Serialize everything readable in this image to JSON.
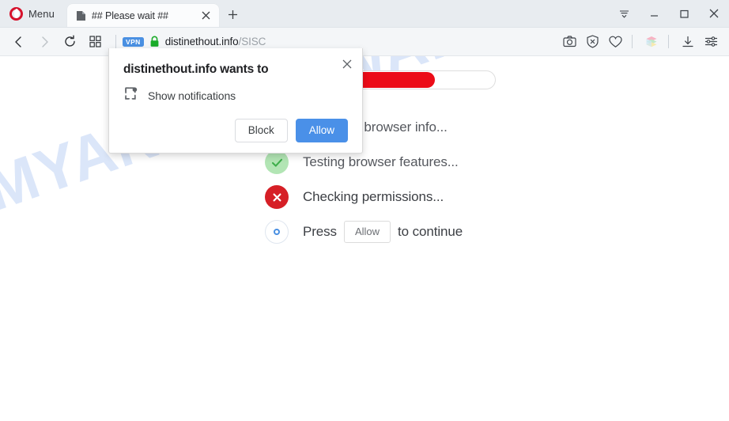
{
  "window": {
    "menu_label": "Menu",
    "opera_logo_color": "#d6122c",
    "controls": {
      "tab_list": "tab-list-chevron",
      "minimize": "minimize",
      "maximize": "maximize",
      "close": "close"
    }
  },
  "tabs": [
    {
      "title": "## Please wait ##",
      "favicon": "page-icon",
      "active": true
    }
  ],
  "newtab_label": "+",
  "toolbar": {
    "back": "back-arrow",
    "forward": "forward-arrow",
    "reload": "reload",
    "grid": "speed-dial-grid",
    "vpn_badge": "VPN",
    "lock": "secure-lock",
    "url_host": "distinethout.info",
    "url_path": "/SISC",
    "right_icons": [
      "snapshot-camera-icon",
      "ad-blocker-shield-icon",
      "heart-icon",
      "workspaces-cube-icon",
      "downloads-icon",
      "easy-setup-icon"
    ]
  },
  "page": {
    "watermark": "MYANTISPYWARE.COM",
    "progress": {
      "percent": 74,
      "fill_color": "#ec0c18"
    },
    "steps": [
      {
        "label": "Analyzing browser info...",
        "state": "ok",
        "glyph": "check"
      },
      {
        "label": "Testing browser features...",
        "state": "ok",
        "glyph": "check"
      },
      {
        "label": "Checking permissions...",
        "state": "bad",
        "glyph": "cross"
      }
    ],
    "press_row": {
      "prefix": "Press",
      "button_label": "Allow",
      "suffix": "to continue",
      "state": "pending"
    }
  },
  "permission_dialog": {
    "title": "distinethout.info wants to",
    "permission_icon": "notification-bell-icon",
    "permission_text": "Show notifications",
    "block_label": "Block",
    "allow_label": "Allow",
    "close_icon": "close-icon",
    "allow_color": "#4a90e8"
  }
}
